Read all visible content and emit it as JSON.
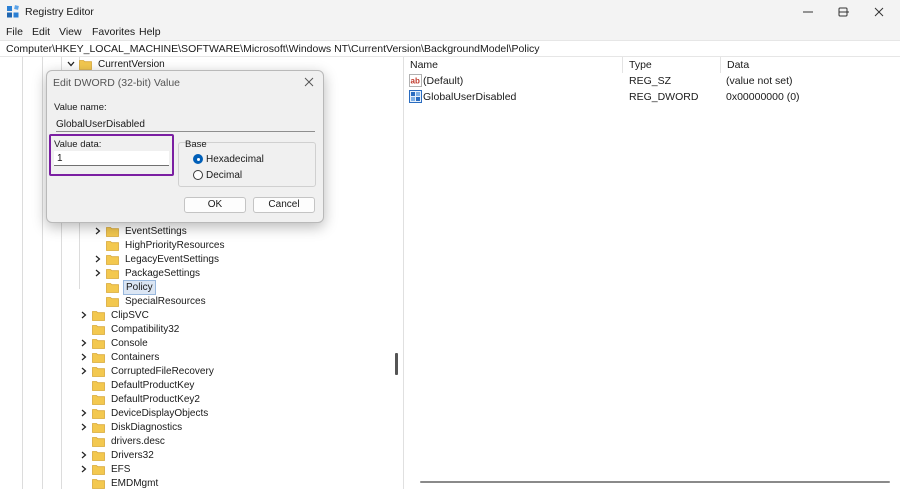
{
  "window": {
    "title": "Registry Editor",
    "icon": "registry-editor-icon",
    "controls": [
      "minimize-icon",
      "maximize-icon",
      "close-icon"
    ]
  },
  "menu": [
    "File",
    "Edit",
    "View",
    "Favorites",
    "Help"
  ],
  "address": "Computer\\HKEY_LOCAL_MACHINE\\SOFTWARE\\Microsoft\\Windows NT\\CurrentVersion\\BackgroundModel\\Policy",
  "tree": {
    "top": {
      "label": "CurrentVersion",
      "expanded": true
    },
    "items": [
      {
        "label": "EventSettings",
        "expandable": true
      },
      {
        "label": "HighPriorityResources",
        "expandable": false
      },
      {
        "label": "LegacyEventSettings",
        "expandable": true
      },
      {
        "label": "PackageSettings",
        "expandable": true
      },
      {
        "label": "Policy",
        "expandable": false,
        "selected": true
      },
      {
        "label": "SpecialResources",
        "expandable": false
      },
      {
        "label": "ClipSVC",
        "expandable": true
      },
      {
        "label": "Compatibility32",
        "expandable": false
      },
      {
        "label": "Console",
        "expandable": true
      },
      {
        "label": "Containers",
        "expandable": true
      },
      {
        "label": "CorruptedFileRecovery",
        "expandable": true
      },
      {
        "label": "DefaultProductKey",
        "expandable": false
      },
      {
        "label": "DefaultProductKey2",
        "expandable": false
      },
      {
        "label": "DeviceDisplayObjects",
        "expandable": true
      },
      {
        "label": "DiskDiagnostics",
        "expandable": true
      },
      {
        "label": "drivers.desc",
        "expandable": false
      },
      {
        "label": "Drivers32",
        "expandable": true
      },
      {
        "label": "EFS",
        "expandable": true
      },
      {
        "label": "EMDMgmt",
        "expandable": false
      }
    ]
  },
  "list": {
    "columns": [
      "Name",
      "Type",
      "Data"
    ],
    "rows": [
      {
        "icon": "string-value-icon",
        "name": "(Default)",
        "type": "REG_SZ",
        "data": "(value not set)"
      },
      {
        "icon": "binary-value-icon",
        "name": "GlobalUserDisabled",
        "type": "REG_DWORD",
        "data": "0x00000000 (0)"
      }
    ]
  },
  "dialog": {
    "title": "Edit DWORD (32-bit) Value",
    "value_name_label": "Value name:",
    "value_name": "GlobalUserDisabled",
    "value_data_label": "Value data:",
    "value_data": "1",
    "base_label": "Base",
    "hexadecimal": "Hexadecimal",
    "decimal": "Decimal",
    "selected_base": "Hexadecimal",
    "ok": "OK",
    "cancel": "Cancel",
    "highlight_color": "#7b1fa2"
  },
  "colors": {
    "folder": "#f3c84f",
    "selection": "#dbe6f4",
    "accent": "#005fb8"
  }
}
